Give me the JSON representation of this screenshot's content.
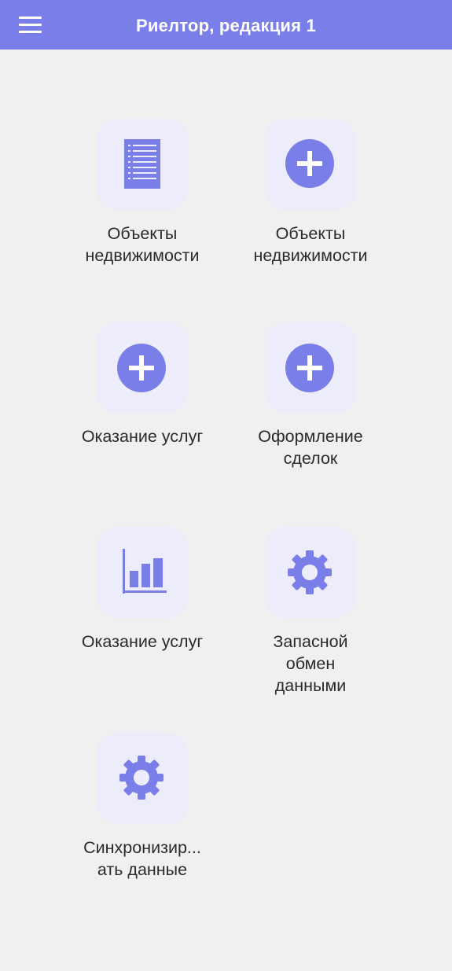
{
  "app": {
    "title": "Риелтор, редакция 1",
    "accent_color": "#7a7ee8",
    "menu_icon": "hamburger-menu-icon"
  },
  "tiles": [
    {
      "line1": "Объекты",
      "line2": "недвижимости",
      "line3": "",
      "icon": "list-document-icon"
    },
    {
      "line1": "Объекты",
      "line2": "недвижимости",
      "line3": "",
      "icon": "plus-circle-icon"
    },
    {
      "line1": "Оказание услуг",
      "line2": "",
      "line3": "",
      "icon": "plus-circle-icon"
    },
    {
      "line1": "Оформление",
      "line2": "сделок",
      "line3": "",
      "icon": "plus-circle-icon"
    },
    {
      "line1": "Оказание услуг",
      "line2": "",
      "line3": "",
      "icon": "bar-chart-icon"
    },
    {
      "line1": "Запасной",
      "line2": "обмен",
      "line3": "данными",
      "icon": "gear-icon"
    },
    {
      "line1": "Синхронизир...",
      "line2": "ать данные",
      "line3": "",
      "icon": "gear-icon"
    }
  ]
}
